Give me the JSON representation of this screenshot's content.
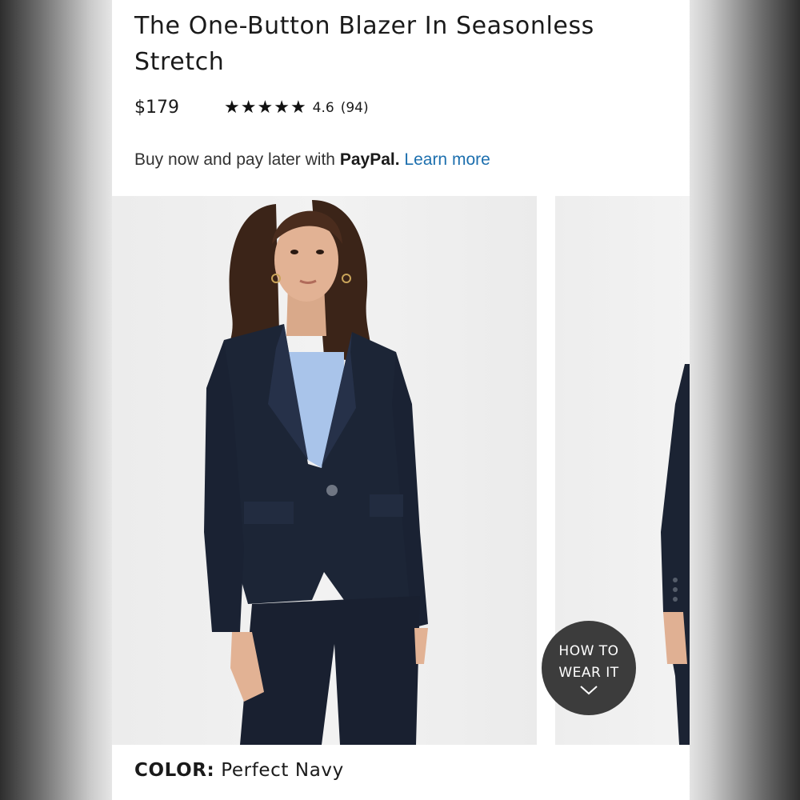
{
  "product": {
    "title": "The One-Button Blazer In Seasonless Stretch",
    "price": "$179",
    "rating": {
      "stars": 5,
      "value": "4.6",
      "count": "(94)"
    }
  },
  "paypal": {
    "text": "Buy now and pay later with",
    "brand": "PayPal.",
    "link": "Learn more"
  },
  "how_to_wear": {
    "line1": "HOW TO",
    "line2": "WEAR IT",
    "icon": "chevron-down-icon"
  },
  "color": {
    "label": "COLOR:",
    "value": "Perfect Navy"
  },
  "colors": {
    "navy": "#1c2536",
    "sweater": "#a9c4ea",
    "link": "#1c6fae",
    "badge": "#3c3c3c"
  }
}
